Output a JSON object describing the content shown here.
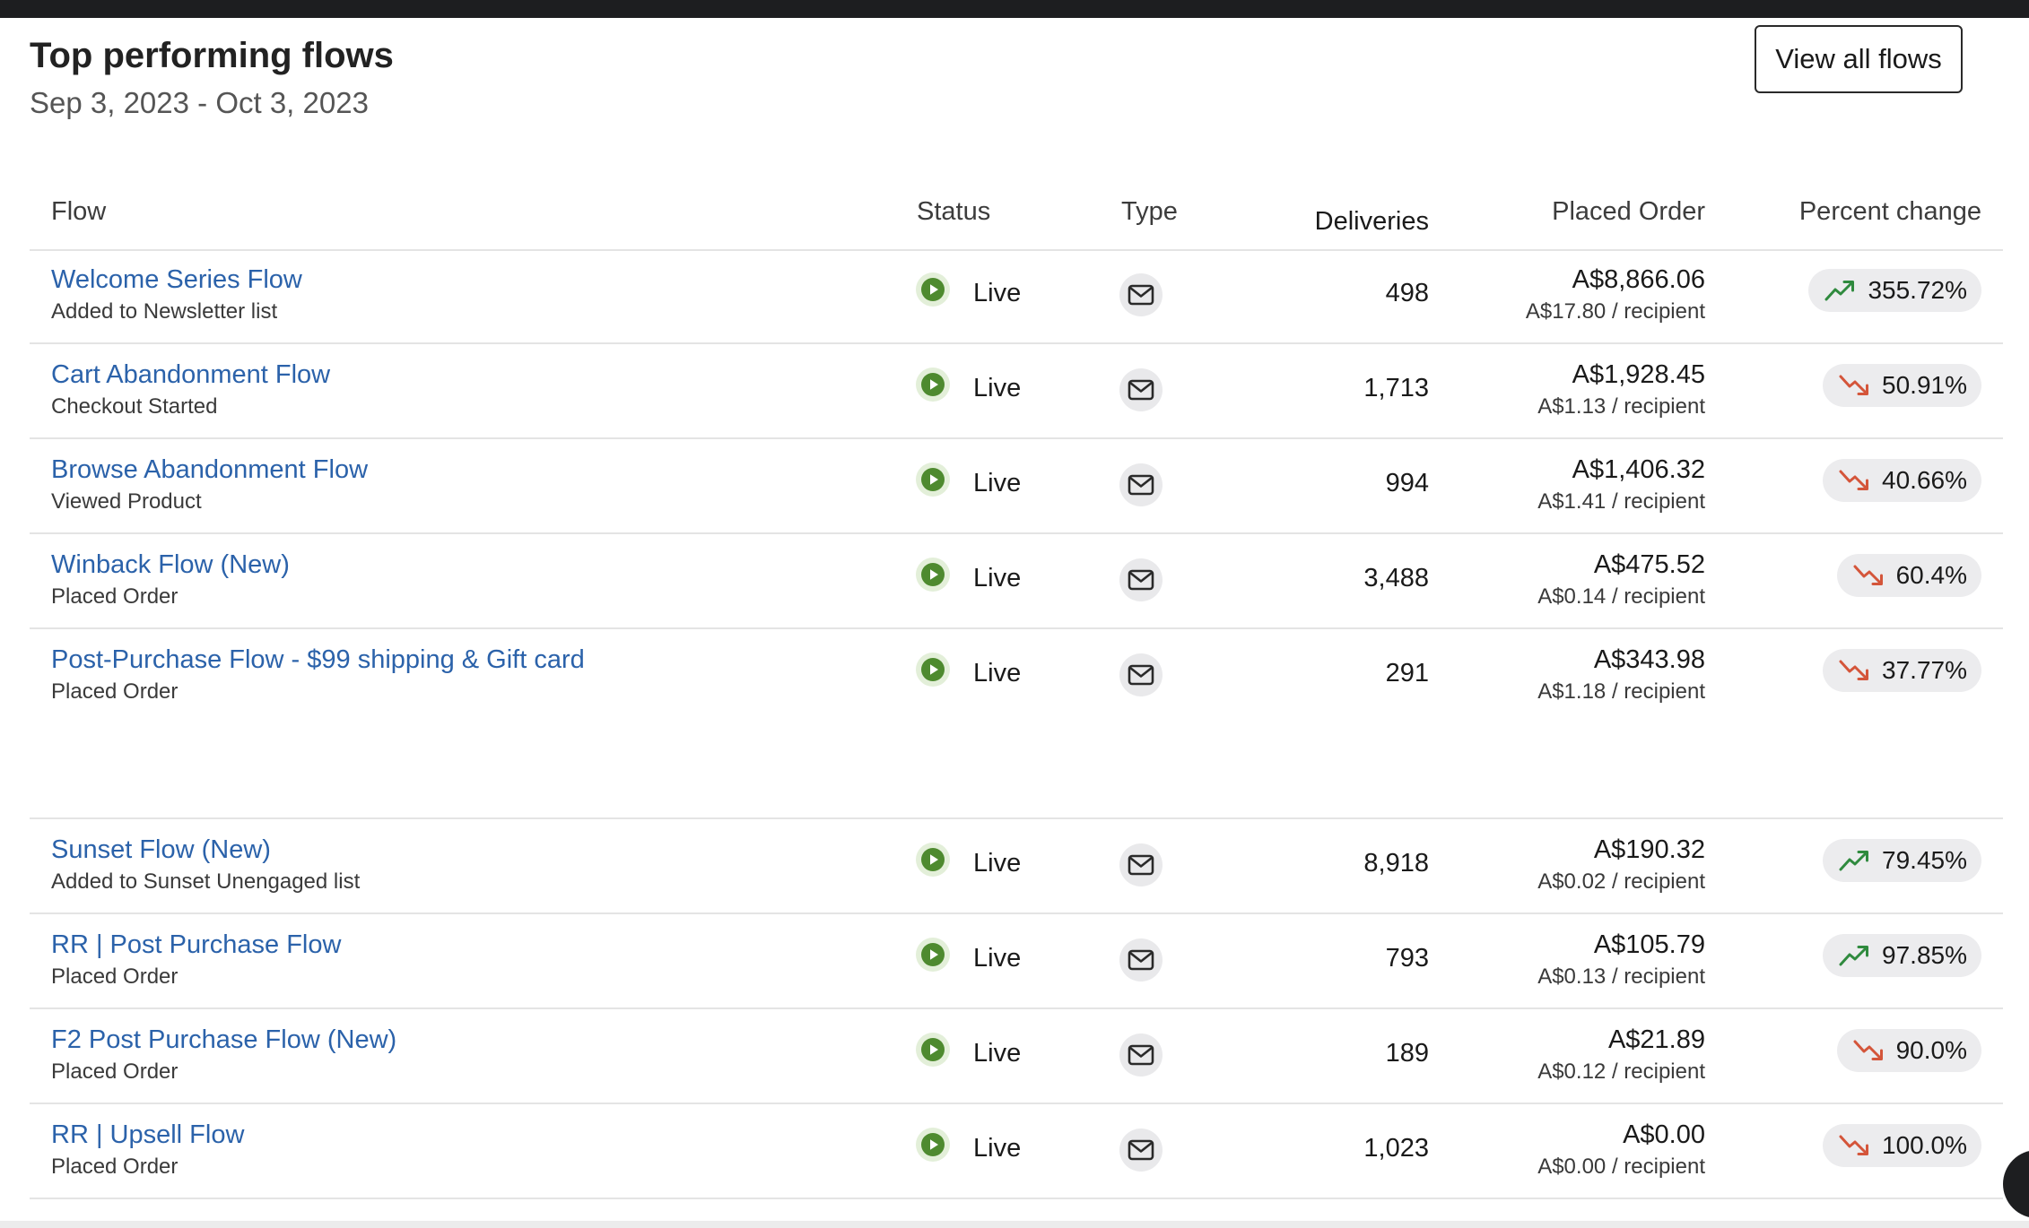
{
  "colors": {
    "link": "#2b62aa",
    "live_green": "#4e8a2f",
    "trend_up": "#2f8a3e",
    "trend_down": "#d4553a"
  },
  "header": {
    "title": "Top performing flows",
    "date_range": "Sep 3, 2023 - Oct 3, 2023",
    "view_all_label": "View all flows"
  },
  "columns": {
    "flow": "Flow",
    "status": "Status",
    "type": "Type",
    "deliveries": "Deliveries",
    "placed_order": "Placed Order",
    "percent_change": "Percent change"
  },
  "rows": [
    {
      "name": "Welcome Series Flow",
      "trigger": "Added to Newsletter list",
      "status": "Live",
      "type_icon": "envelope-icon",
      "deliveries": "498",
      "placed_order": "A$8,866.06",
      "per_recipient": "A$17.80 / recipient",
      "trend": "up",
      "percent": "355.72%"
    },
    {
      "name": "Cart Abandonment Flow",
      "trigger": "Checkout Started",
      "status": "Live",
      "type_icon": "envelope-icon",
      "deliveries": "1,713",
      "placed_order": "A$1,928.45",
      "per_recipient": "A$1.13 / recipient",
      "trend": "down",
      "percent": "50.91%"
    },
    {
      "name": "Browse Abandonment Flow",
      "trigger": "Viewed Product",
      "status": "Live",
      "type_icon": "envelope-icon",
      "deliveries": "994",
      "placed_order": "A$1,406.32",
      "per_recipient": "A$1.41 / recipient",
      "trend": "down",
      "percent": "40.66%"
    },
    {
      "name": "Winback Flow (New)",
      "trigger": "Placed Order",
      "status": "Live",
      "type_icon": "envelope-icon",
      "deliveries": "3,488",
      "placed_order": "A$475.52",
      "per_recipient": "A$0.14 / recipient",
      "trend": "down",
      "percent": "60.4%"
    },
    {
      "name": "Post-Purchase Flow - $99 shipping & Gift card",
      "trigger": "Placed Order",
      "status": "Live",
      "type_icon": "envelope-icon",
      "deliveries": "291",
      "placed_order": "A$343.98",
      "per_recipient": "A$1.18 / recipient",
      "trend": "down",
      "percent": "37.77%"
    },
    {
      "name": "Sunset Flow (New)",
      "trigger": "Added to Sunset Unengaged list",
      "status": "Live",
      "type_icon": "envelope-icon",
      "deliveries": "8,918",
      "placed_order": "A$190.32",
      "per_recipient": "A$0.02 / recipient",
      "trend": "up",
      "percent": "79.45%"
    },
    {
      "name": "RR | Post Purchase Flow",
      "trigger": "Placed Order",
      "status": "Live",
      "type_icon": "envelope-icon",
      "deliveries": "793",
      "placed_order": "A$105.79",
      "per_recipient": "A$0.13 / recipient",
      "trend": "up",
      "percent": "97.85%"
    },
    {
      "name": "F2 Post Purchase Flow (New)",
      "trigger": "Placed Order",
      "status": "Live",
      "type_icon": "envelope-icon",
      "deliveries": "189",
      "placed_order": "A$21.89",
      "per_recipient": "A$0.12 / recipient",
      "trend": "down",
      "percent": "90.0%"
    },
    {
      "name": "RR | Upsell Flow",
      "trigger": "Placed Order",
      "status": "Live",
      "type_icon": "envelope-icon",
      "deliveries": "1,023",
      "placed_order": "A$0.00",
      "per_recipient": "A$0.00 / recipient",
      "trend": "down",
      "percent": "100.0%"
    }
  ]
}
